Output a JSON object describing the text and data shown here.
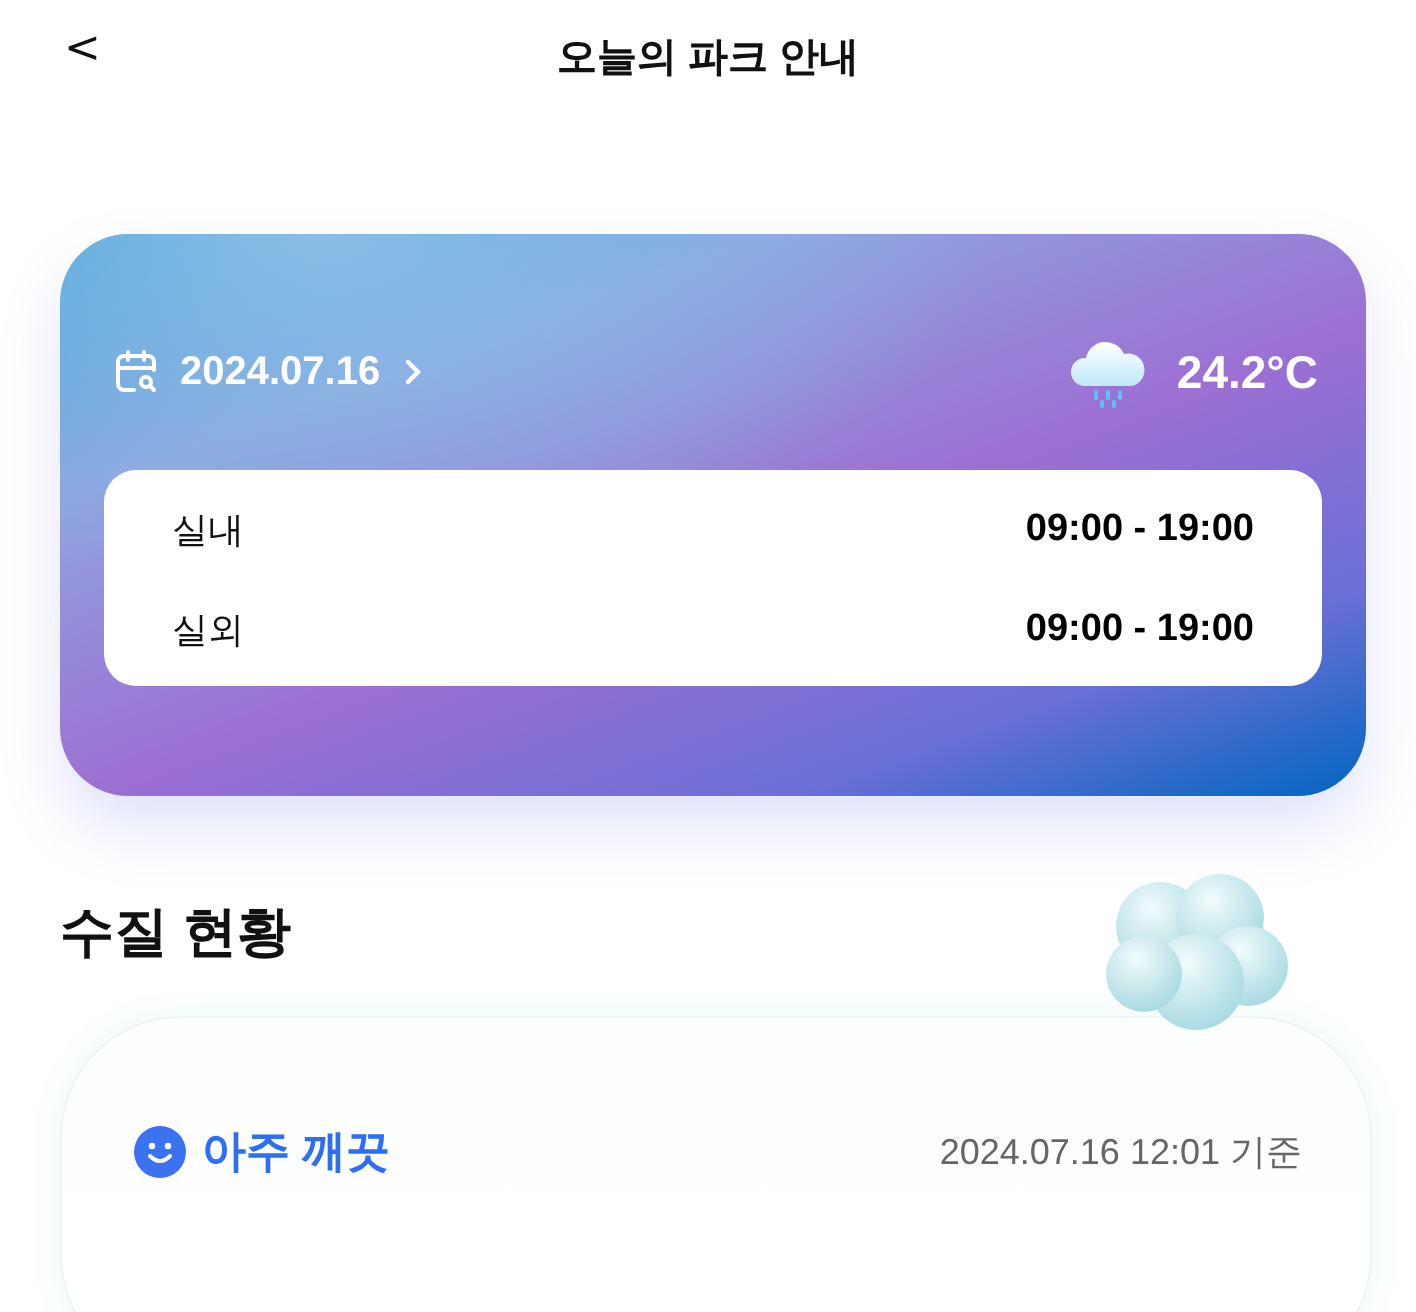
{
  "header": {
    "back": "<",
    "title": "오늘의 파크 안내"
  },
  "park_card": {
    "date": "2024.07.16",
    "temperature": "24.2°C",
    "hours": [
      {
        "label": "실내",
        "time": "09:00 - 19:00"
      },
      {
        "label": "실외",
        "time": "09:00 - 19:00"
      }
    ]
  },
  "water_quality": {
    "title": "수질 현황",
    "status": "아주 깨끗",
    "updated": "2024.07.16 12:01 기준"
  }
}
